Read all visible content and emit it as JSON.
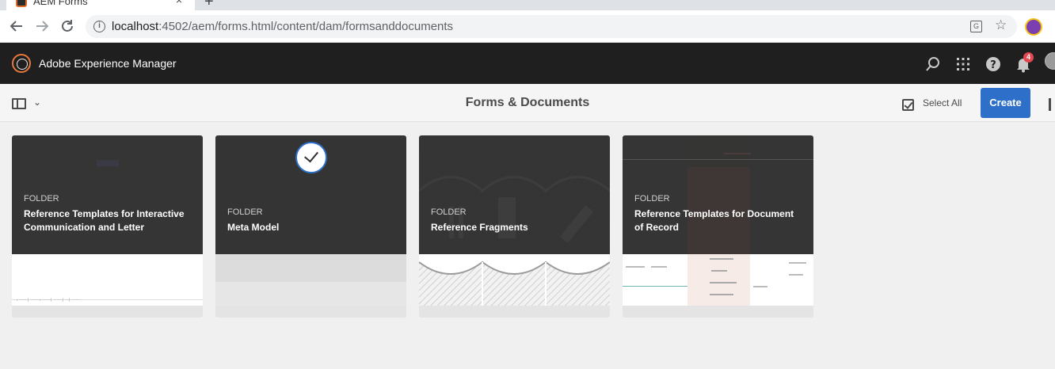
{
  "browser": {
    "tab_title": "AEM Forms",
    "tab_close": "×",
    "new_tab": "+",
    "url_host": "localhost",
    "url_path": ":4502/aem/forms.html/content/dam/formsanddocuments"
  },
  "header": {
    "title": "Adobe Experience Manager",
    "notification_count": "4"
  },
  "actionbar": {
    "page_title": "Forms & Documents",
    "select_all_label": "Select All",
    "create_label": "Create"
  },
  "cards": [
    {
      "type": "FOLDER",
      "title": "Reference Templates for Interactive Communication and Letter",
      "selected": false
    },
    {
      "type": "FOLDER",
      "title": "Meta Model",
      "selected": true
    },
    {
      "type": "FOLDER",
      "title": "Reference Fragments",
      "selected": false
    },
    {
      "type": "FOLDER",
      "title": "Reference Templates for Document of Record",
      "selected": false
    }
  ],
  "colors": {
    "accent": "#2d6fc9",
    "header_bg": "#1f1f1f",
    "badge": "#e34850"
  }
}
